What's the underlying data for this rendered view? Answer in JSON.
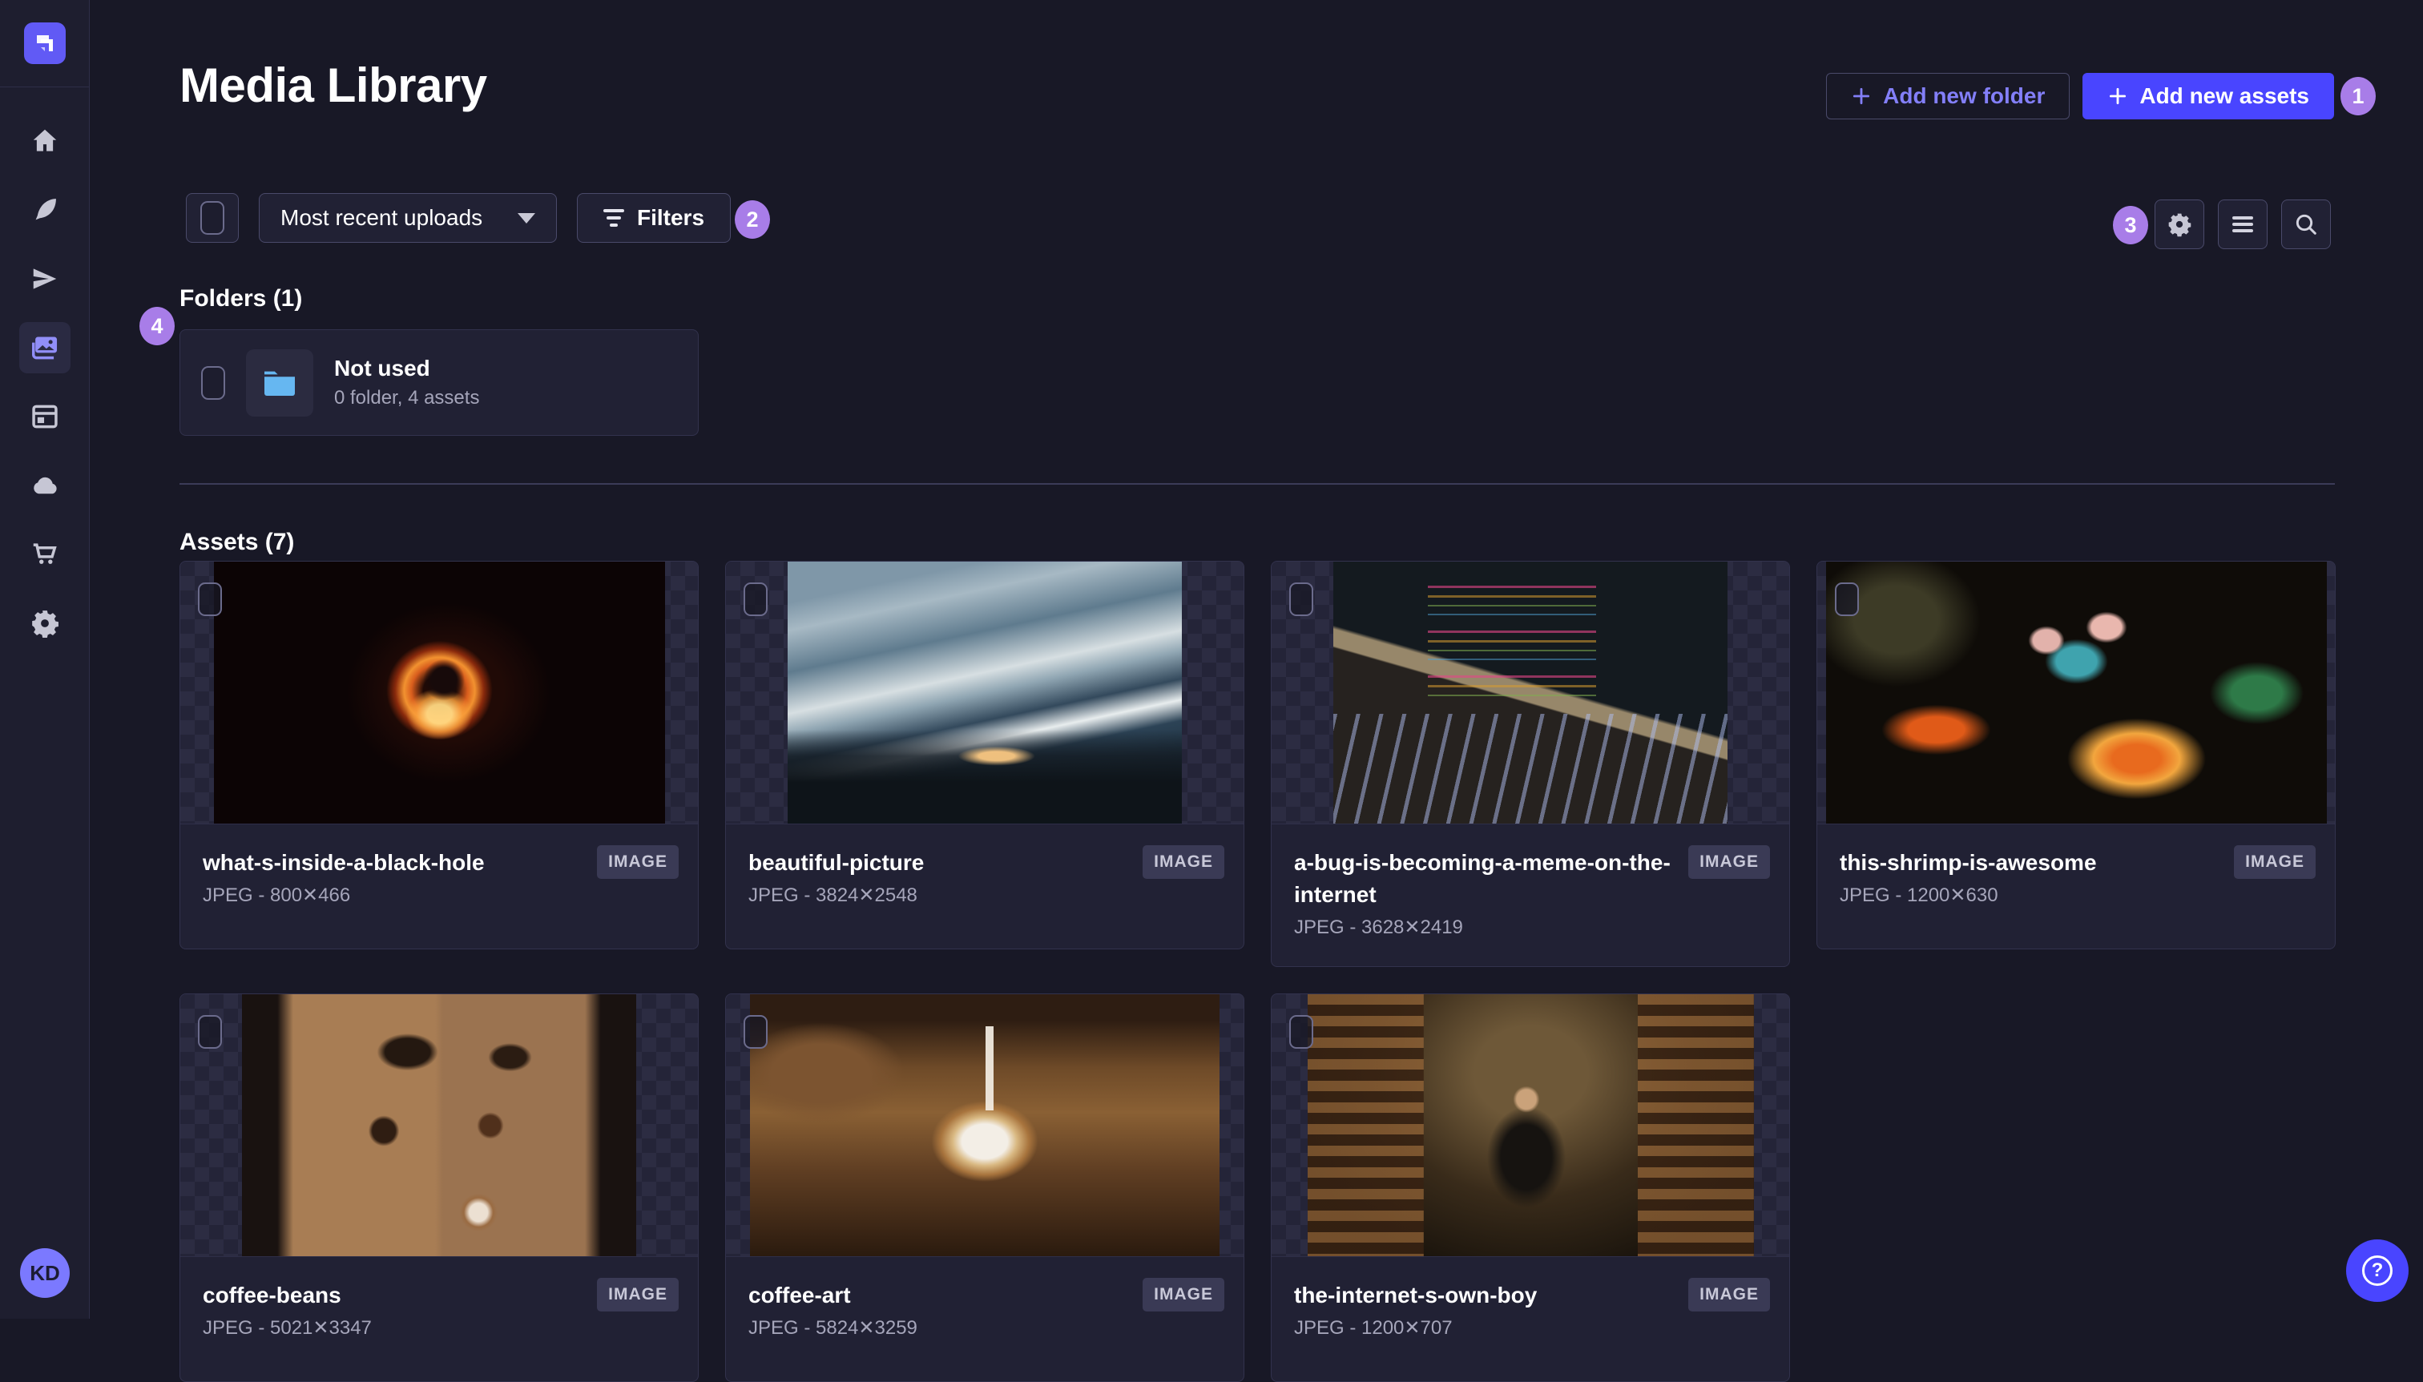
{
  "header": {
    "title": "Media Library",
    "add_folder_label": "Add new folder",
    "add_assets_label": "Add new assets"
  },
  "toolbar": {
    "sort_value": "Most recent uploads",
    "filters_label": "Filters",
    "view_icons": [
      "gear-icon",
      "list-icon",
      "search-icon"
    ]
  },
  "sidebar": {
    "logo_icon": "strapi-logo",
    "items": [
      {
        "icon": "home-icon",
        "active": false
      },
      {
        "icon": "feather-icon",
        "active": false
      },
      {
        "icon": "paper-plane-icon",
        "active": false
      },
      {
        "icon": "media-library-icon",
        "active": true
      },
      {
        "icon": "content-manager-icon",
        "active": false
      },
      {
        "icon": "cloud-icon",
        "active": false
      },
      {
        "icon": "cart-icon",
        "active": false
      },
      {
        "icon": "gear-icon",
        "active": false
      }
    ],
    "user_initials": "KD"
  },
  "folders": {
    "heading": "Folders (1)",
    "items": [
      {
        "name": "Not used",
        "meta": "0 folder, 4 assets"
      }
    ]
  },
  "assets": {
    "heading": "Assets (7)",
    "items": [
      {
        "name": "what-s-inside-a-black-hole",
        "meta": "JPEG - 800✕466",
        "badge": "IMAGE"
      },
      {
        "name": "beautiful-picture",
        "meta": "JPEG - 3824✕2548",
        "badge": "IMAGE"
      },
      {
        "name": "a-bug-is-becoming-a-meme-on-the-internet",
        "meta": "JPEG - 3628✕2419",
        "badge": "IMAGE"
      },
      {
        "name": "this-shrimp-is-awesome",
        "meta": "JPEG - 1200✕630",
        "badge": "IMAGE"
      },
      {
        "name": "coffee-beans",
        "meta": "JPEG - 5021✕3347",
        "badge": "IMAGE"
      },
      {
        "name": "coffee-art",
        "meta": "JPEG - 5824✕3259",
        "badge": "IMAGE"
      },
      {
        "name": "the-internet-s-own-boy",
        "meta": "JPEG - 1200✕707",
        "badge": "IMAGE"
      }
    ]
  },
  "annotations": {
    "b1": "1",
    "b2": "2",
    "b3": "3",
    "b4": "4"
  },
  "help": {
    "icon_glyph": "?"
  },
  "colors": {
    "background": "#181826",
    "surface": "#212134",
    "border": "#32324d",
    "accent": "#4945ff",
    "accent_light": "#7b79ff",
    "annotation": "#a87de8",
    "text_muted": "#a5a5ba",
    "folder_icon_blue": "#66b7f1"
  }
}
